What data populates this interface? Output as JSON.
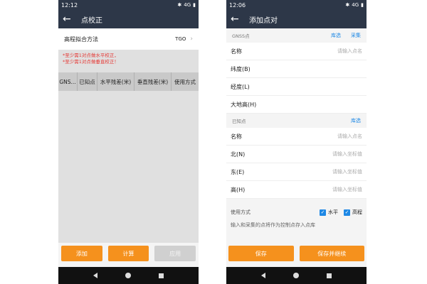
{
  "phone1": {
    "status": {
      "time": "12:12",
      "network": "4G"
    },
    "title": "点校正",
    "method": {
      "label": "高程拟合方法",
      "value": "TGO"
    },
    "warnings": [
      "*至少需1对点做水平校正，",
      "*至少需1对点做垂直校正！"
    ],
    "table_headers": [
      "GNS...",
      "已知点",
      "水平残差(米)",
      "垂直残差(米)",
      "使用方式"
    ],
    "buttons": {
      "add": "添加",
      "calc": "计算",
      "apply": "应用"
    }
  },
  "phone2": {
    "status": {
      "time": "12:06",
      "network": "4G"
    },
    "title": "添加点对",
    "gnss_section": {
      "label": "GNSS点",
      "filter": "库选",
      "collect": "采集"
    },
    "gnss_fields": [
      {
        "label": "名称",
        "placeholder": "请输入点名"
      },
      {
        "label": "纬度(B)",
        "placeholder": ""
      },
      {
        "label": "经度(L)",
        "placeholder": ""
      },
      {
        "label": "大地高(H)",
        "placeholder": ""
      }
    ],
    "known_section": {
      "label": "已知点",
      "filter": "库选"
    },
    "known_fields": [
      {
        "label": "名称",
        "placeholder": "请输入点名"
      },
      {
        "label": "北(N)",
        "placeholder": "请输入坐标值"
      },
      {
        "label": "东(E)",
        "placeholder": "请输入坐标值"
      },
      {
        "label": "高(H)",
        "placeholder": "请输入坐标值"
      }
    ],
    "usage": {
      "label": "使用方式",
      "horizontal": "水平",
      "vertical": "高程"
    },
    "hint": "输入和采集的点将作为控制点存入点库",
    "buttons": {
      "save": "保存",
      "save_continue": "保存并继续"
    }
  }
}
